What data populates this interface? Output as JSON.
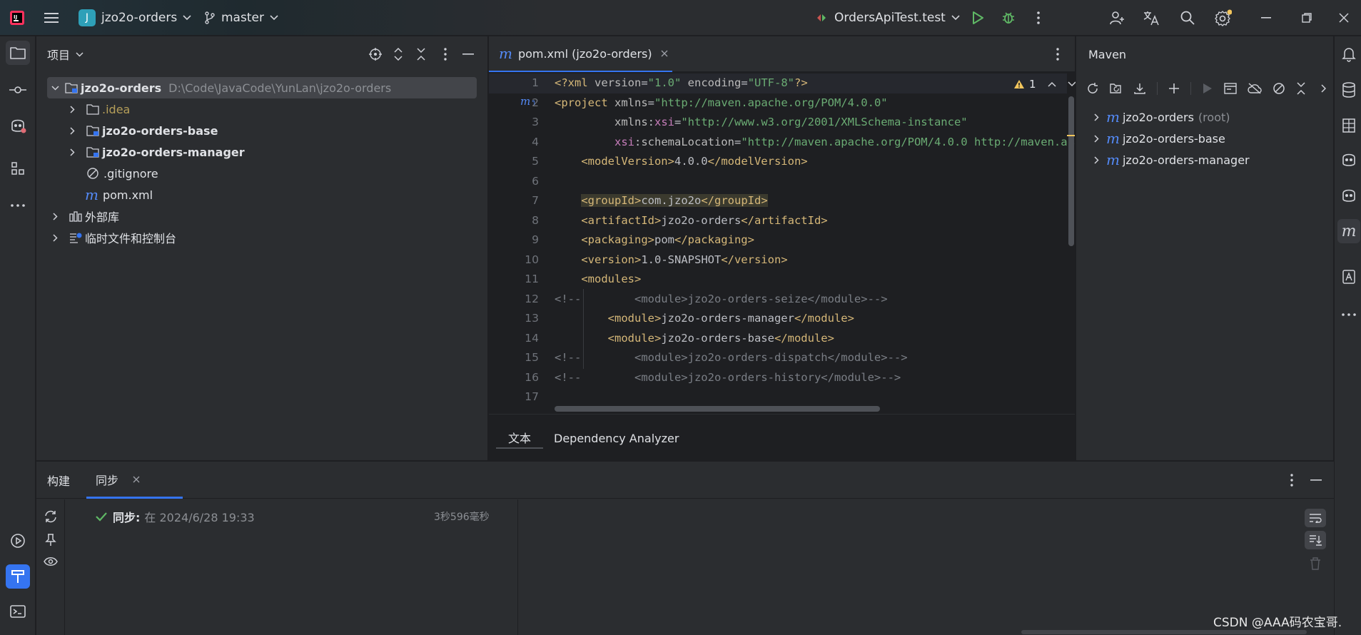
{
  "titlebar": {
    "project_badge": "J",
    "project_name": "jzo2o-orders",
    "branch": "master",
    "run_config": "OrdersApiTest.test"
  },
  "project_panel": {
    "title": "项目",
    "tree": [
      {
        "label": "jzo2o-orders",
        "path": "D:\\Code\\JavaCode\\YunLan\\jzo2o-orders",
        "type": "module-root"
      },
      {
        "label": ".idea",
        "type": "folder"
      },
      {
        "label": "jzo2o-orders-base",
        "type": "module"
      },
      {
        "label": "jzo2o-orders-manager",
        "type": "module"
      },
      {
        "label": ".gitignore",
        "type": "ignore"
      },
      {
        "label": "pom.xml",
        "type": "maven"
      },
      {
        "label": "外部库",
        "type": "library"
      },
      {
        "label": "临时文件和控制台",
        "type": "scratch"
      }
    ]
  },
  "editor": {
    "tab_label": "pom.xml (jzo2o-orders)",
    "warning_count": "1",
    "line_numbers": [
      "1",
      "2",
      "3",
      "4",
      "5",
      "6",
      "7",
      "8",
      "9",
      "10",
      "11",
      "12",
      "13",
      "14",
      "15",
      "16",
      "17"
    ],
    "bottom_tabs": [
      "文本",
      "Dependency Analyzer"
    ],
    "active_bottom_tab": "文本"
  },
  "maven": {
    "title": "Maven",
    "items": [
      {
        "label": "jzo2o-orders",
        "suffix": "(root)"
      },
      {
        "label": "jzo2o-orders-base",
        "suffix": ""
      },
      {
        "label": "jzo2o-orders-manager",
        "suffix": ""
      }
    ]
  },
  "build": {
    "tabs": [
      "构建",
      "同步"
    ],
    "active_tab": "同步",
    "sync_label": "同步:",
    "sync_detail": "在 2024/6/28 19:33",
    "duration": "3秒596毫秒"
  },
  "watermark": "CSDN @AAA码农宝哥.",
  "colors": {
    "accent": "#3574f0",
    "run_green": "#5fb865",
    "warning": "#f2c55c",
    "project_badge": "#2ea0b8"
  }
}
